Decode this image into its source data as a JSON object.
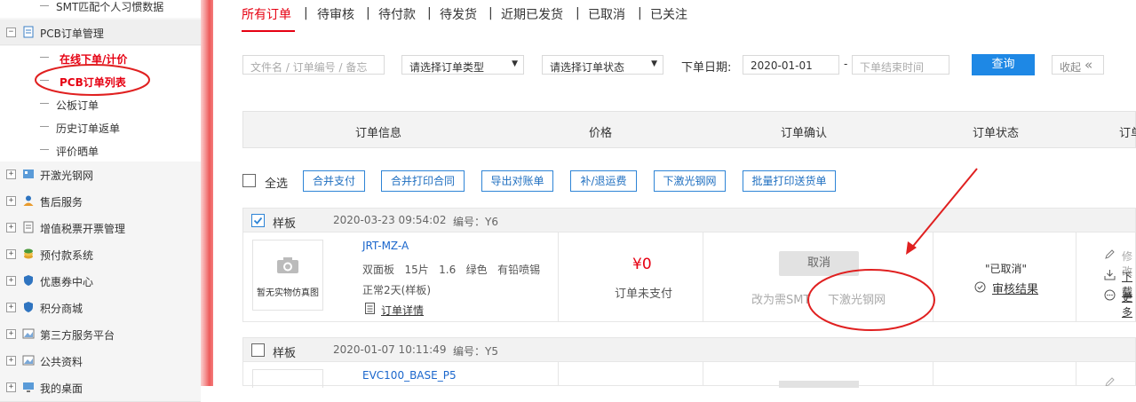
{
  "sidebar": {
    "top_sub_item": "SMT匹配个人习惯数据",
    "pcb_group": "PCB订单管理",
    "pcb_items": [
      "在线下单/计价",
      "PCB订单列表",
      "公板订单",
      "历史订单返单",
      "评价晒单"
    ],
    "groups": [
      "开激光钢网",
      "售后服务",
      "增值税票开票管理",
      "预付款系统",
      "优惠券中心",
      "积分商城",
      "第三方服务平台",
      "公共资料",
      "我的桌面"
    ]
  },
  "tabs": [
    "所有订单",
    "待审核",
    "待付款",
    "待发货",
    "近期已发货",
    "已取消",
    "已关注"
  ],
  "filters": {
    "search_placeholder": "文件名 / 订单编号 / 备忘",
    "type_select": "请选择订单类型",
    "status_select": "请选择订单状态",
    "date_label": "下单日期:",
    "start_date": "2020-01-01",
    "date_sep": "-",
    "end_placeholder": "下单结束时间",
    "query": "查询",
    "collapse": "收起"
  },
  "table_headers": [
    "订单信息",
    "价格",
    "订单确认",
    "订单状态",
    "订单"
  ],
  "bulk": {
    "select_all": "全选",
    "buttons": [
      "合并支付",
      "合并打印合同",
      "导出对账单",
      "补/退运费",
      "下激光钢网",
      "批量打印送货单"
    ]
  },
  "orders": [
    {
      "tag": "样板",
      "time": "2020-03-23 09:54:02",
      "no_label": "编号：Y6",
      "image_text": "暂无实物仿真图",
      "name": "JRT-MZ-A",
      "specs": "双面板   15片   1.6   绿色   有铅喷锡",
      "lead": "正常2天(样板)",
      "detail": "订单详情",
      "price": "¥0",
      "pay_status": "订单未支付",
      "cancel": "取消",
      "to_smt": "改为需SMT",
      "laser": "下激光钢网",
      "state": "\"已取消\"",
      "review": "审核结果",
      "actions": [
        "修改",
        "下载",
        "更多"
      ]
    },
    {
      "tag": "样板",
      "time": "2020-01-07 10:11:49",
      "no_label": "编号：Y5",
      "name": "EVC100_BASE_P5"
    }
  ],
  "colors": {
    "accent_red": "#e60012",
    "primary_blue": "#1e88e5",
    "link_blue": "#1a66cc"
  }
}
